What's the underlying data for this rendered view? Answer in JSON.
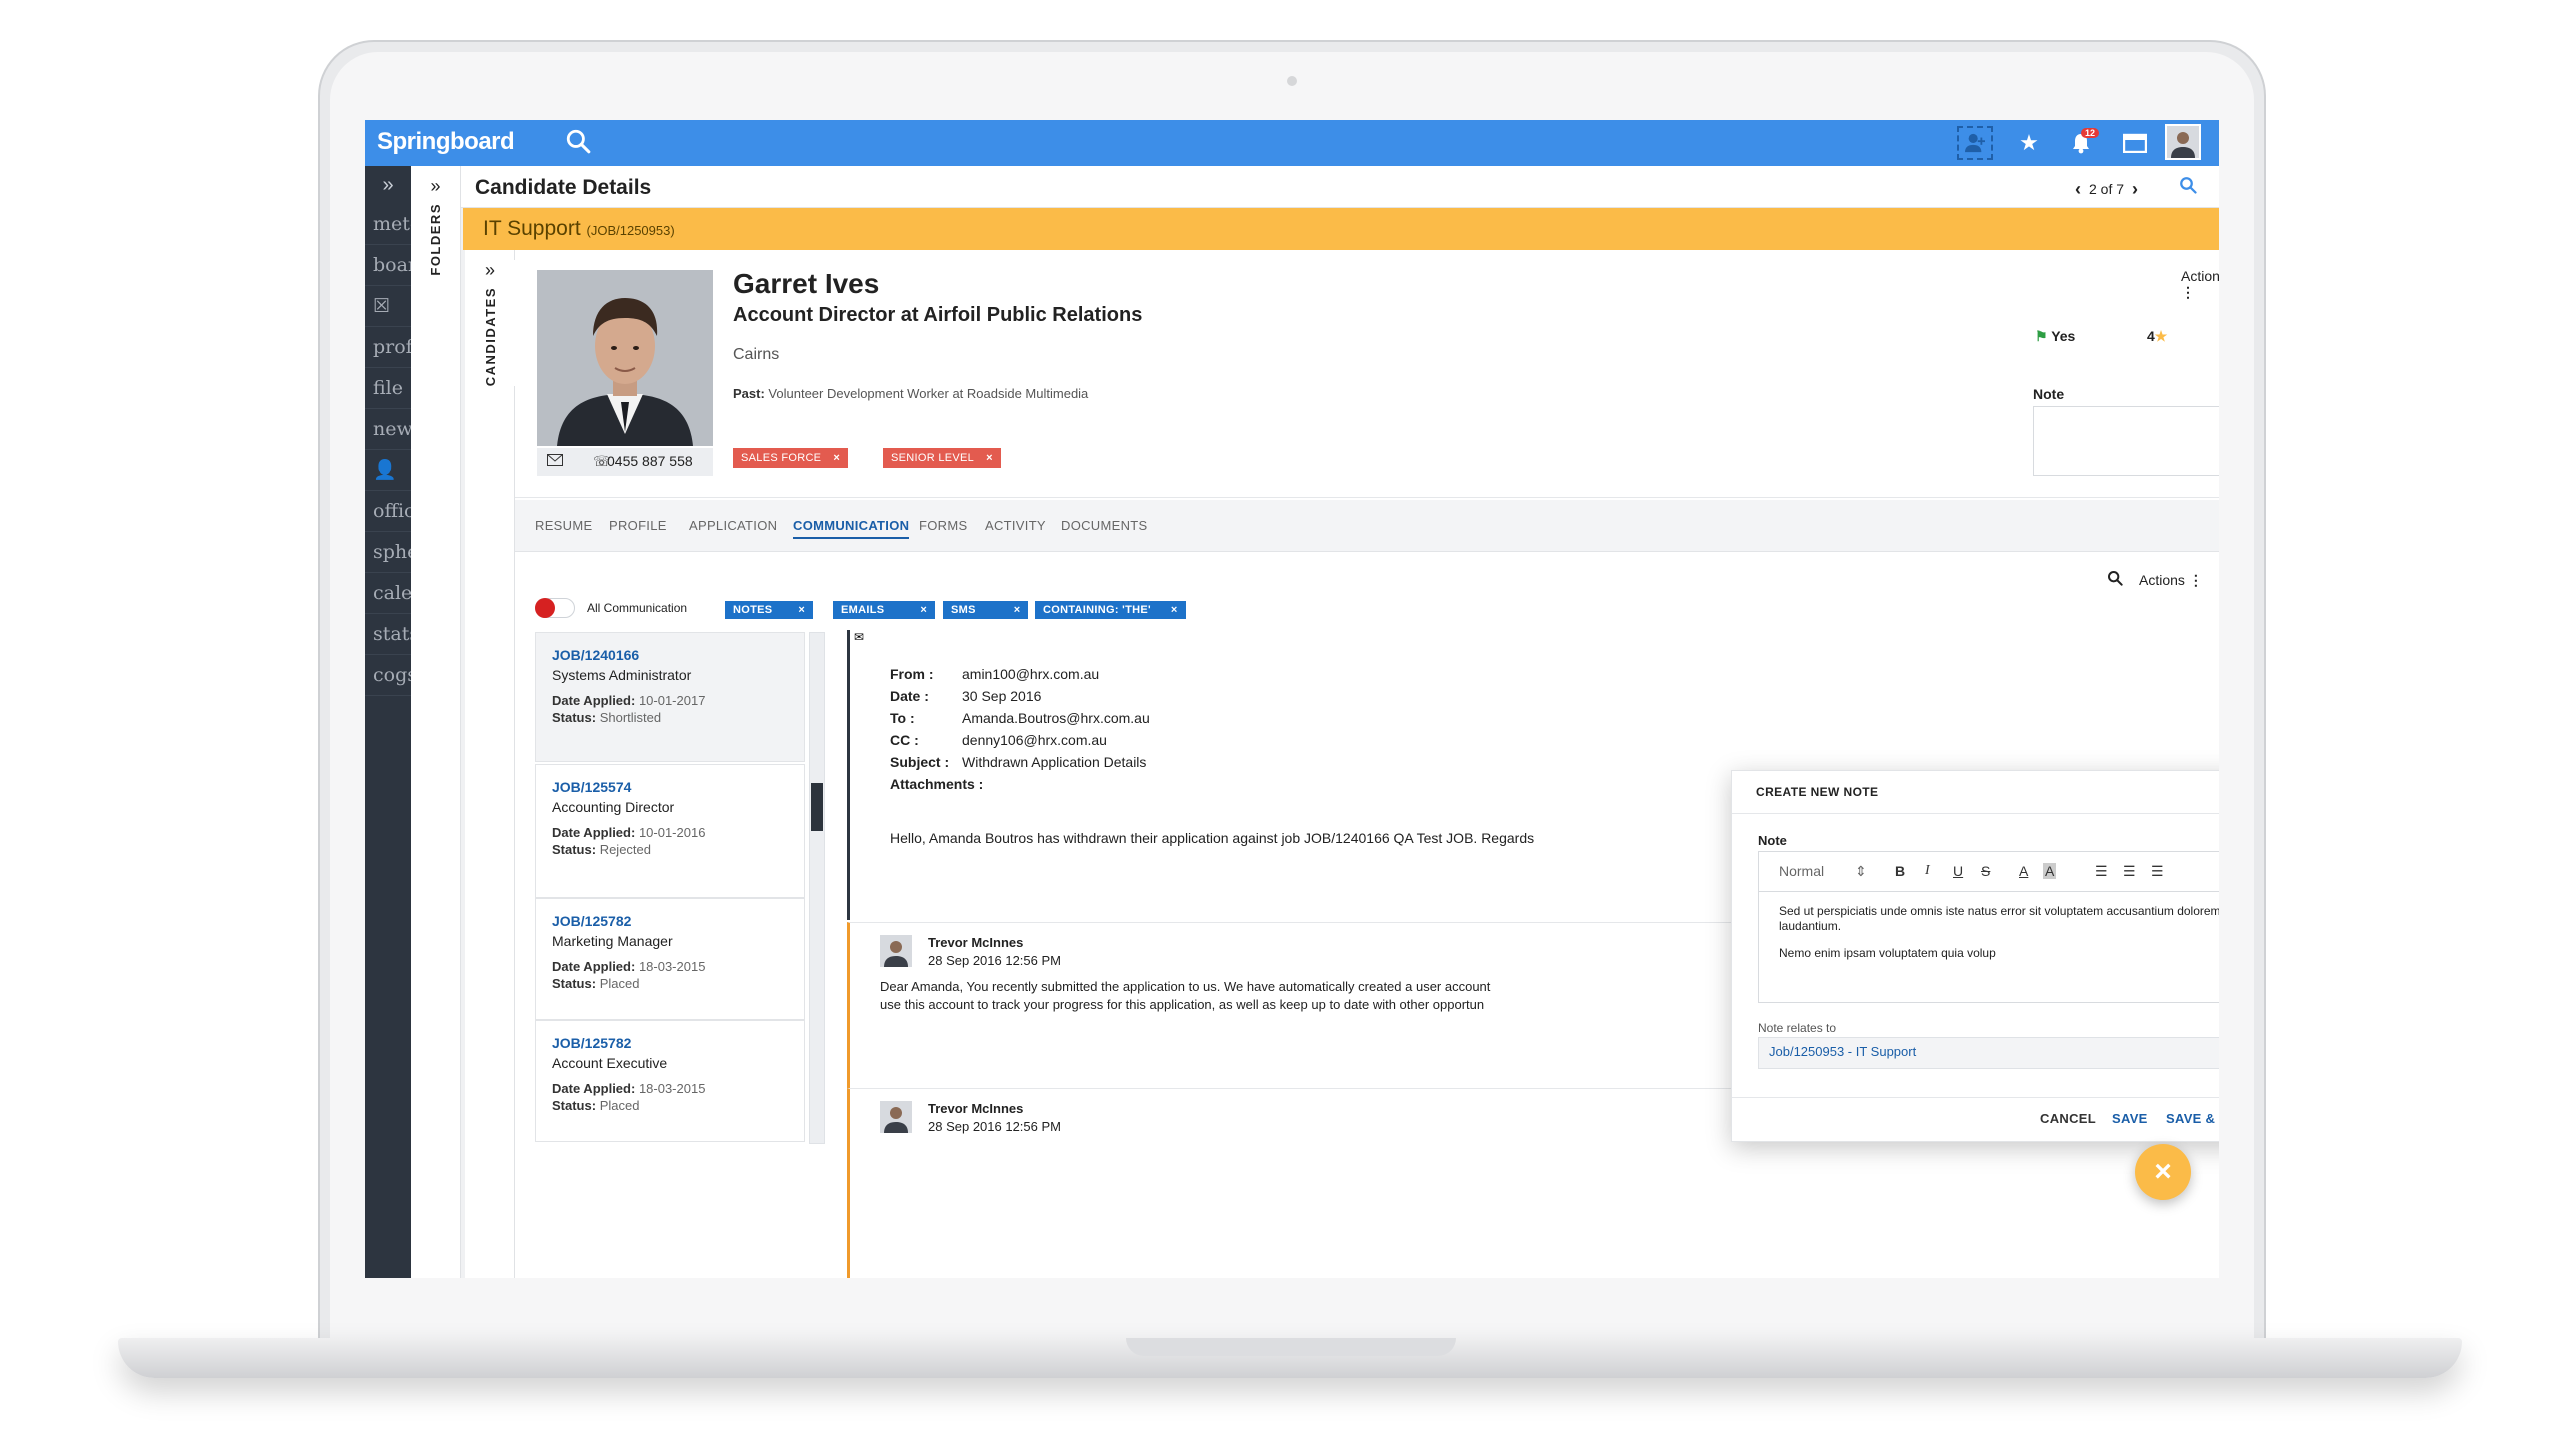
{
  "app": {
    "logo_text": "Springboard"
  },
  "topbar": {
    "notification_count": "12"
  },
  "leftnav": {
    "expand_glyph": "»",
    "items": [
      "mete",
      "boar",
      "☒",
      "prof",
      "file",
      "new",
      "👤",
      "offic",
      "sphe",
      "cale",
      "stats",
      "cogs"
    ]
  },
  "folders": {
    "label": "FOLDERS",
    "expand_glyph": "»"
  },
  "candidates_strip": {
    "label": "CANDIDATES",
    "expand_glyph": "»"
  },
  "header": {
    "title": "Candidate Details",
    "pager_text": "2 of 7"
  },
  "job_banner": {
    "title": "IT Support",
    "code": "(JOB/1250953)"
  },
  "candidate": {
    "name": "Garret Ives",
    "role": "Account Director at Airfoil Public Relations",
    "location": "Cairns",
    "past_label": "Past:",
    "past_value": "Volunteer Development Worker at Roadside Multimedia",
    "phone": "0455 887 558",
    "tags": [
      {
        "label": "SALES FORCE"
      },
      {
        "label": "SENIOR LEVEL"
      }
    ],
    "flag_value": "Yes",
    "rating": "4",
    "note_label": "Note",
    "actions_label": "Actions"
  },
  "tabs": [
    "RESUME",
    "PROFILE",
    "APPLICATION",
    "COMMUNICATION",
    "FORMS",
    "ACTIVITY",
    "DOCUMENTS"
  ],
  "active_tab": "COMMUNICATION",
  "communication": {
    "actions_label": "Actions",
    "toggle_label": "All Communication",
    "filters": [
      "NOTES",
      "EMAILS",
      "SMS",
      "CONTAINING: 'THE'"
    ],
    "applications": [
      {
        "job_id": "JOB/1240166",
        "title": "Systems Administrator",
        "date_label": "Date Applied:",
        "date": "10-01-2017",
        "status_label": "Status:",
        "status": "Shortlisted"
      },
      {
        "job_id": "JOB/125574",
        "title": "Accounting Director",
        "date_label": "Date Applied:",
        "date": "10-01-2016",
        "status_label": "Status:",
        "status": "Rejected"
      },
      {
        "job_id": "JOB/125782",
        "title": "Marketing Manager",
        "date_label": "Date Applied:",
        "date": "18-03-2015",
        "status_label": "Status:",
        "status": "Placed"
      },
      {
        "job_id": "JOB/125782",
        "title": "Account Executive",
        "date_label": "Date Applied:",
        "date": "18-03-2015",
        "status_label": "Status:",
        "status": "Placed"
      }
    ],
    "email": {
      "from_label": "From :",
      "from": "amin100@hrx.com.au",
      "date_label": "Date :",
      "date": "30 Sep 2016",
      "to_label": "To :",
      "to": "Amanda.Boutros@hrx.com.au",
      "cc_label": "CC :",
      "cc": "denny106@hrx.com.au",
      "subject_label": "Subject :",
      "subject": "Withdrawn Application Details",
      "attachments_label": "Attachments :",
      "body": "Hello, Amanda Boutros has withdrawn their application against job JOB/1240166 QA Test JOB. Regards"
    },
    "thread": [
      {
        "author": "Trevor McInnes",
        "timestamp": "28 Sep 2016 12:56 PM",
        "body_line1": "Dear Amanda, You recently submitted the application to us. We have automatically created a user account",
        "body_line2": "use this account to track your progress for this application, as well as keep up to date with other opportun"
      },
      {
        "author": "Trevor McInnes",
        "timestamp": "28 Sep 2016 12:56 PM"
      }
    ]
  },
  "note_modal": {
    "title": "CREATE NEW NOTE",
    "note_label": "Note",
    "format_select": "Normal",
    "content_line1": "Sed ut perspiciatis unde omnis iste natus error sit voluptatem accusantium doloremque laudantium.",
    "content_line2": "Nemo enim ipsam voluptatem quia volup",
    "relates_label": "Note relates to",
    "relates_value": "Job/1250953 - IT Support",
    "cancel_label": "CANCEL",
    "save_label": "SAVE",
    "save_next_label": "SAVE & NEXT CANDIDATE"
  },
  "colors": {
    "topbar": "#3d8ee8",
    "banner": "#fbbb48",
    "tag": "#e35b4f",
    "filter": "#1d72c9",
    "link": "#1a5ea8",
    "nav": "#2d3540"
  }
}
